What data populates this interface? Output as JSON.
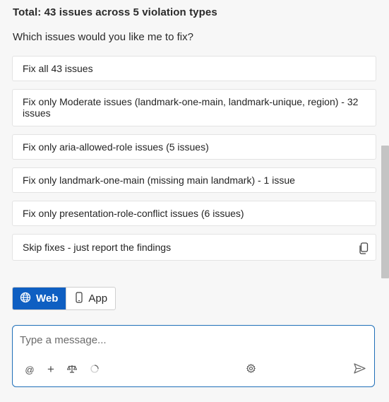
{
  "summary": {
    "title": "Total: 43 issues across 5 violation types",
    "question": "Which issues would you like me to fix?"
  },
  "options": [
    {
      "label": "Fix all 43 issues"
    },
    {
      "label": "Fix only Moderate issues (landmark-one-main, landmark-unique, region) - 32 issues"
    },
    {
      "label": "Fix only aria-allowed-role issues (5 issues)"
    },
    {
      "label": "Fix only landmark-one-main (missing main landmark) - 1 issue"
    },
    {
      "label": "Fix only presentation-role-conflict issues (6 issues)"
    },
    {
      "label": "Skip fixes - just report the findings"
    }
  ],
  "toggle": {
    "web_label": "Web",
    "app_label": "App",
    "selected": "Web"
  },
  "composer": {
    "placeholder": "Type a message...",
    "mention_symbol": "@",
    "add_symbol": "+"
  },
  "icons": {
    "copy": "copy-icon",
    "globe": "globe-icon",
    "phone": "phone-icon",
    "scale": "balance-icon",
    "spinner": "loading-icon",
    "settings": "gear-icon",
    "send": "send-icon"
  },
  "colors": {
    "accent": "#0f5fc2",
    "composer_border": "#1f6fb8",
    "background": "#f7f7f7"
  }
}
